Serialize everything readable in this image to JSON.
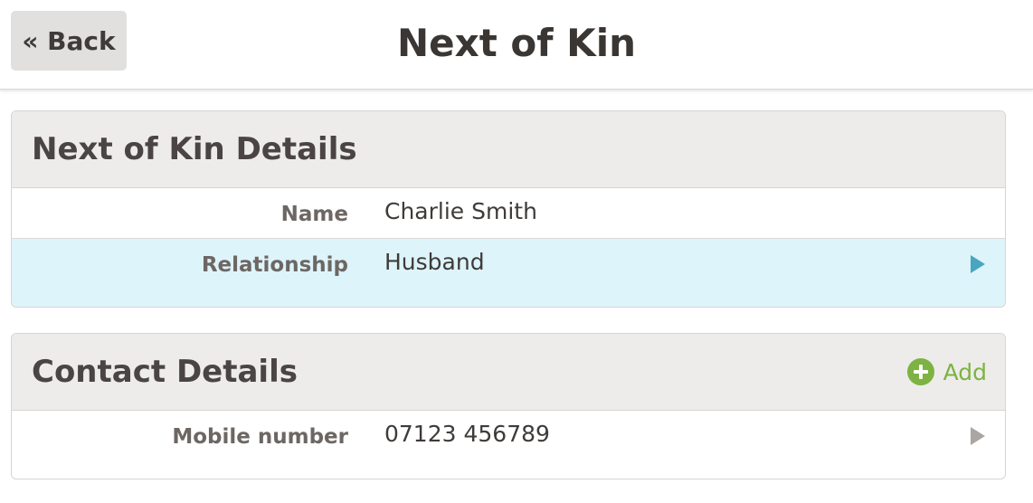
{
  "header": {
    "back_label": "« Back",
    "title": "Next of Kin"
  },
  "kin_panel": {
    "title": "Next of Kin Details",
    "rows": [
      {
        "label": "Name",
        "value": "Charlie Smith"
      },
      {
        "label": "Relationship",
        "value": "Husband"
      }
    ]
  },
  "contact_panel": {
    "title": "Contact Details",
    "add_label": "Add",
    "rows": [
      {
        "label": "Mobile number",
        "value": "07123 456789"
      }
    ]
  },
  "colors": {
    "highlight_row": "#def4fb",
    "accent_blue": "#4aa5c1",
    "add_green": "#7cb342"
  },
  "icons": [
    "plus-circle-icon",
    "chevron-right-icon"
  ]
}
